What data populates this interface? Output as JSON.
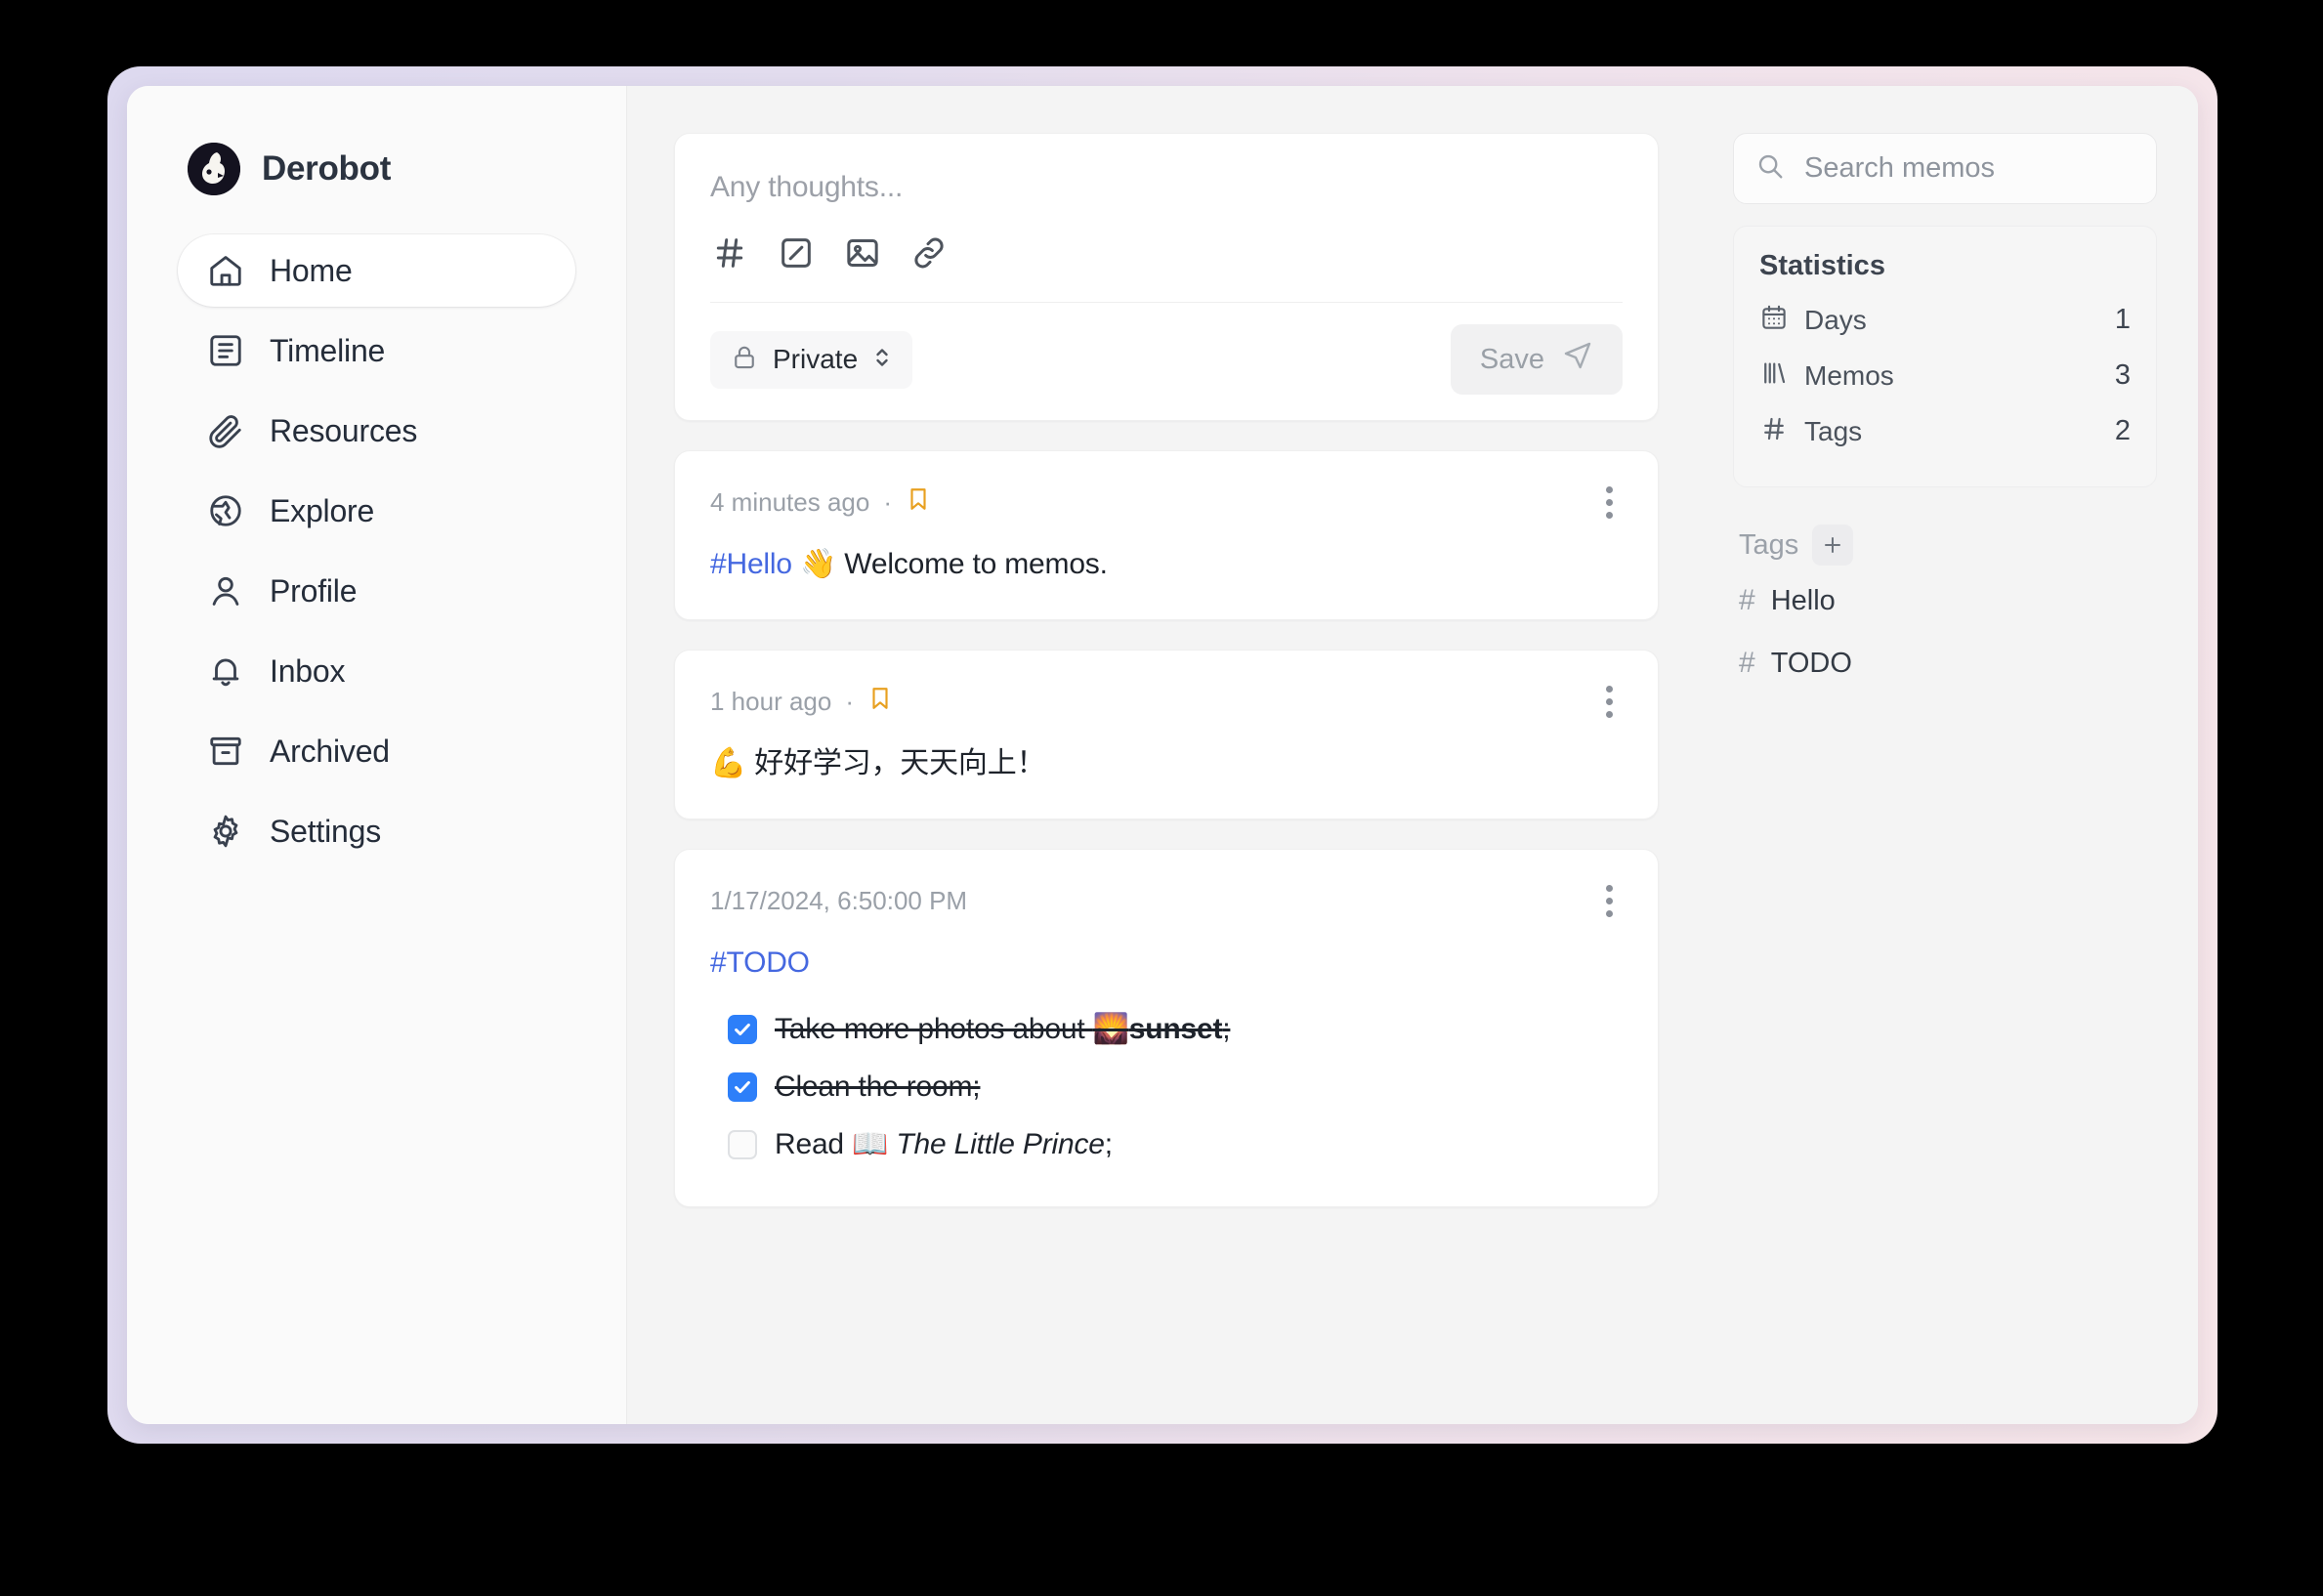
{
  "app": {
    "brand_name": "Derobot"
  },
  "sidebar": {
    "items": [
      {
        "label": "Home",
        "icon": "home-icon",
        "active": true
      },
      {
        "label": "Timeline",
        "icon": "timeline-icon",
        "active": false
      },
      {
        "label": "Resources",
        "icon": "paperclip-icon",
        "active": false
      },
      {
        "label": "Explore",
        "icon": "globe-icon",
        "active": false
      },
      {
        "label": "Profile",
        "icon": "user-icon",
        "active": false
      },
      {
        "label": "Inbox",
        "icon": "bell-icon",
        "active": false
      },
      {
        "label": "Archived",
        "icon": "archive-icon",
        "active": false
      },
      {
        "label": "Settings",
        "icon": "gear-icon",
        "active": false
      }
    ]
  },
  "editor": {
    "placeholder": "Any thoughts...",
    "tools": [
      "hash-icon",
      "checkbox-task-icon",
      "image-icon",
      "link-icon"
    ],
    "visibility": "Private",
    "visibility_icon": "lock-icon",
    "save_label": "Save",
    "save_icon": "send-icon",
    "save_enabled": false
  },
  "memos": [
    {
      "time": "4 minutes ago",
      "separator": "·",
      "bookmarked": true,
      "tag": "#Hello",
      "text": " 👋 Welcome to memos."
    },
    {
      "time": "1 hour ago",
      "separator": "·",
      "bookmarked": true,
      "text": "💪 好好学习，天天向上！"
    },
    {
      "time": "1/17/2024, 6:50:00 PM",
      "bookmarked": false,
      "tag": "#TODO",
      "tasks": [
        {
          "checked": true,
          "prefix": "Take more photos about ",
          "emoji": "🌄",
          "bold": "sunset",
          "suffix": ";"
        },
        {
          "checked": true,
          "prefix": "Clean the room;",
          "emoji": "",
          "bold": "",
          "suffix": ""
        },
        {
          "checked": false,
          "prefix": "Read ",
          "emoji": "📖",
          "italic": "The Little Prince",
          "suffix": ";"
        }
      ]
    }
  ],
  "search": {
    "placeholder": "Search memos",
    "icon": "search-icon",
    "value": ""
  },
  "statistics": {
    "title": "Statistics",
    "rows": [
      {
        "label": "Days",
        "value": "1",
        "icon": "calendar-icon"
      },
      {
        "label": "Memos",
        "value": "3",
        "icon": "library-icon"
      },
      {
        "label": "Tags",
        "value": "2",
        "icon": "hash-icon"
      }
    ]
  },
  "tags": {
    "title": "Tags",
    "add_icon": "plus-icon",
    "items": [
      {
        "label": "Hello"
      },
      {
        "label": "TODO"
      }
    ]
  },
  "colors": {
    "accent_blue": "#4568e0",
    "checkbox_blue": "#2d7ff9",
    "bookmark_orange": "#e8a020",
    "frame_left": "#ddd9ef",
    "frame_right": "#f7e6e9"
  }
}
